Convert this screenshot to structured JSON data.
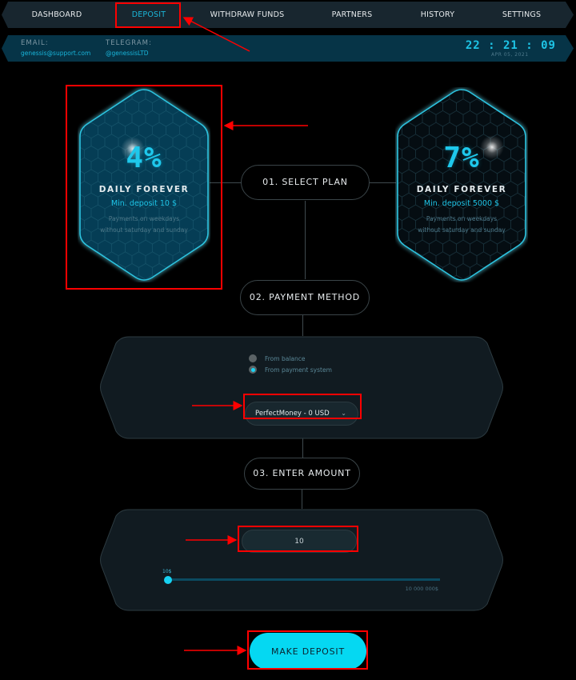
{
  "nav": {
    "items": [
      {
        "label": "Dashboard",
        "active": false
      },
      {
        "label": "Deposit",
        "active": true
      },
      {
        "label": "Withdraw funds",
        "active": false
      },
      {
        "label": "Partners",
        "active": false
      },
      {
        "label": "History",
        "active": false
      },
      {
        "label": "Settings",
        "active": false
      }
    ]
  },
  "info": {
    "email_label": "EMAIL:",
    "email_value": "genessis@support.com",
    "telegram_label": "TELEGRAM:",
    "telegram_value": "@genessisLTD",
    "clock_time": "22 : 21 : 09",
    "clock_date": "APR 05, 2021"
  },
  "plans": [
    {
      "rate": "4%",
      "title": "DAILY FOREVER",
      "min_deposit": "Min. deposit 10 $",
      "desc_line1": "Payments on weekdays",
      "desc_line2": "without saturday and sunday",
      "selected": true
    },
    {
      "rate": "7%",
      "title": "DAILY FOREVER",
      "min_deposit": "Min. deposit 5000 $",
      "desc_line1": "Payments on weekdays",
      "desc_line2": "without saturday and sunday",
      "selected": false
    }
  ],
  "steps": {
    "step1": "01. Select plan",
    "step2": "02. Payment method",
    "step3": "03. Enter amount"
  },
  "payment": {
    "options": [
      {
        "label": "From balance",
        "checked": false
      },
      {
        "label": "From payment system",
        "checked": true
      }
    ],
    "selected_system": "PerfectMoney - 0 USD",
    "chevron": "chevron-down-icon"
  },
  "amount": {
    "value": "10",
    "slider_min_label": "10$",
    "slider_max_label": "10 000 000$",
    "slider_fraction": 0.0
  },
  "submit_label": "Make deposit",
  "colors": {
    "accent": "#05d8f2",
    "nav_bg": "#18262f",
    "info_bg": "#063447",
    "annotation": "#ff0000"
  }
}
